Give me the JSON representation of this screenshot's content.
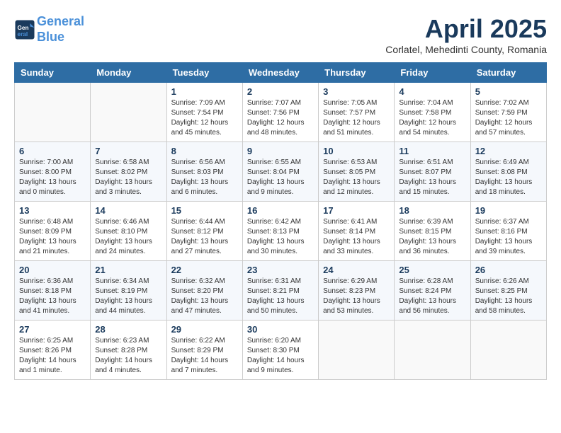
{
  "header": {
    "logo_line1": "General",
    "logo_line2": "Blue",
    "month_title": "April 2025",
    "subtitle": "Corlatel, Mehedinti County, Romania"
  },
  "days_of_week": [
    "Sunday",
    "Monday",
    "Tuesday",
    "Wednesday",
    "Thursday",
    "Friday",
    "Saturday"
  ],
  "weeks": [
    [
      {
        "day": "",
        "info": ""
      },
      {
        "day": "",
        "info": ""
      },
      {
        "day": "1",
        "info": "Sunrise: 7:09 AM\nSunset: 7:54 PM\nDaylight: 12 hours and 45 minutes."
      },
      {
        "day": "2",
        "info": "Sunrise: 7:07 AM\nSunset: 7:56 PM\nDaylight: 12 hours and 48 minutes."
      },
      {
        "day": "3",
        "info": "Sunrise: 7:05 AM\nSunset: 7:57 PM\nDaylight: 12 hours and 51 minutes."
      },
      {
        "day": "4",
        "info": "Sunrise: 7:04 AM\nSunset: 7:58 PM\nDaylight: 12 hours and 54 minutes."
      },
      {
        "day": "5",
        "info": "Sunrise: 7:02 AM\nSunset: 7:59 PM\nDaylight: 12 hours and 57 minutes."
      }
    ],
    [
      {
        "day": "6",
        "info": "Sunrise: 7:00 AM\nSunset: 8:00 PM\nDaylight: 13 hours and 0 minutes."
      },
      {
        "day": "7",
        "info": "Sunrise: 6:58 AM\nSunset: 8:02 PM\nDaylight: 13 hours and 3 minutes."
      },
      {
        "day": "8",
        "info": "Sunrise: 6:56 AM\nSunset: 8:03 PM\nDaylight: 13 hours and 6 minutes."
      },
      {
        "day": "9",
        "info": "Sunrise: 6:55 AM\nSunset: 8:04 PM\nDaylight: 13 hours and 9 minutes."
      },
      {
        "day": "10",
        "info": "Sunrise: 6:53 AM\nSunset: 8:05 PM\nDaylight: 13 hours and 12 minutes."
      },
      {
        "day": "11",
        "info": "Sunrise: 6:51 AM\nSunset: 8:07 PM\nDaylight: 13 hours and 15 minutes."
      },
      {
        "day": "12",
        "info": "Sunrise: 6:49 AM\nSunset: 8:08 PM\nDaylight: 13 hours and 18 minutes."
      }
    ],
    [
      {
        "day": "13",
        "info": "Sunrise: 6:48 AM\nSunset: 8:09 PM\nDaylight: 13 hours and 21 minutes."
      },
      {
        "day": "14",
        "info": "Sunrise: 6:46 AM\nSunset: 8:10 PM\nDaylight: 13 hours and 24 minutes."
      },
      {
        "day": "15",
        "info": "Sunrise: 6:44 AM\nSunset: 8:12 PM\nDaylight: 13 hours and 27 minutes."
      },
      {
        "day": "16",
        "info": "Sunrise: 6:42 AM\nSunset: 8:13 PM\nDaylight: 13 hours and 30 minutes."
      },
      {
        "day": "17",
        "info": "Sunrise: 6:41 AM\nSunset: 8:14 PM\nDaylight: 13 hours and 33 minutes."
      },
      {
        "day": "18",
        "info": "Sunrise: 6:39 AM\nSunset: 8:15 PM\nDaylight: 13 hours and 36 minutes."
      },
      {
        "day": "19",
        "info": "Sunrise: 6:37 AM\nSunset: 8:16 PM\nDaylight: 13 hours and 39 minutes."
      }
    ],
    [
      {
        "day": "20",
        "info": "Sunrise: 6:36 AM\nSunset: 8:18 PM\nDaylight: 13 hours and 41 minutes."
      },
      {
        "day": "21",
        "info": "Sunrise: 6:34 AM\nSunset: 8:19 PM\nDaylight: 13 hours and 44 minutes."
      },
      {
        "day": "22",
        "info": "Sunrise: 6:32 AM\nSunset: 8:20 PM\nDaylight: 13 hours and 47 minutes."
      },
      {
        "day": "23",
        "info": "Sunrise: 6:31 AM\nSunset: 8:21 PM\nDaylight: 13 hours and 50 minutes."
      },
      {
        "day": "24",
        "info": "Sunrise: 6:29 AM\nSunset: 8:23 PM\nDaylight: 13 hours and 53 minutes."
      },
      {
        "day": "25",
        "info": "Sunrise: 6:28 AM\nSunset: 8:24 PM\nDaylight: 13 hours and 56 minutes."
      },
      {
        "day": "26",
        "info": "Sunrise: 6:26 AM\nSunset: 8:25 PM\nDaylight: 13 hours and 58 minutes."
      }
    ],
    [
      {
        "day": "27",
        "info": "Sunrise: 6:25 AM\nSunset: 8:26 PM\nDaylight: 14 hours and 1 minute."
      },
      {
        "day": "28",
        "info": "Sunrise: 6:23 AM\nSunset: 8:28 PM\nDaylight: 14 hours and 4 minutes."
      },
      {
        "day": "29",
        "info": "Sunrise: 6:22 AM\nSunset: 8:29 PM\nDaylight: 14 hours and 7 minutes."
      },
      {
        "day": "30",
        "info": "Sunrise: 6:20 AM\nSunset: 8:30 PM\nDaylight: 14 hours and 9 minutes."
      },
      {
        "day": "",
        "info": ""
      },
      {
        "day": "",
        "info": ""
      },
      {
        "day": "",
        "info": ""
      }
    ]
  ]
}
